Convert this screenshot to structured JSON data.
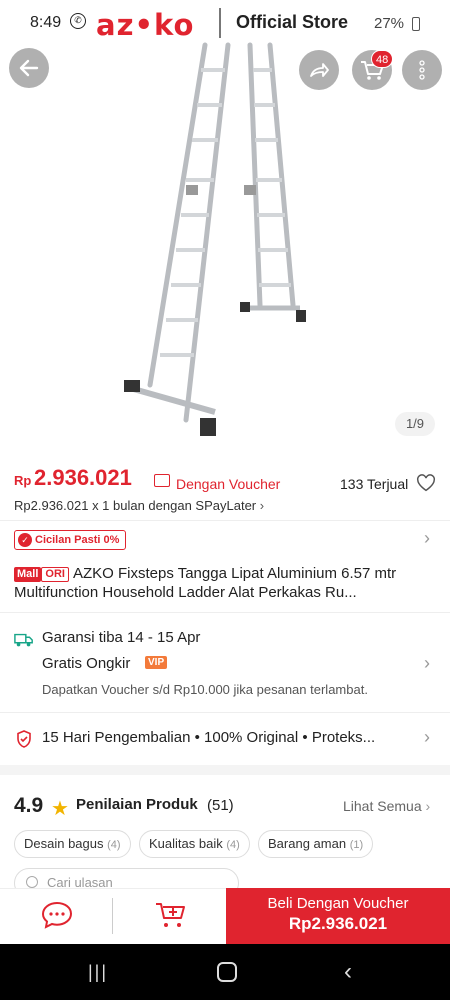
{
  "status_bar": {
    "time": "8:49",
    "battery": "27%"
  },
  "header": {
    "brand": "azko",
    "store_label": "Official Store",
    "cart_count": "48"
  },
  "gallery": {
    "counter": "1/9"
  },
  "price": {
    "currency": "Rp",
    "amount": "2.936.021",
    "voucher_label": "Dengan Voucher",
    "sold": "133 Terjual",
    "installment": "Rp2.936.021 x 1 bulan dengan SPayLater"
  },
  "cicilan": {
    "label": "Cicilan Pasti 0%"
  },
  "product": {
    "mall_badge": "Mall",
    "ori_badge": "ORI",
    "title": "AZKO Fixsteps Tangga Lipat Aluminium 6.57 mtr Multifunction Household Ladder Alat Perkakas Ru..."
  },
  "shipping": {
    "guarantee": "Garansi tiba 14 - 15 Apr",
    "free_shipping": "Gratis Ongkir",
    "vip": "VIP",
    "late_voucher": "Dapatkan Voucher s/d Rp10.000 jika pesanan terlambat."
  },
  "guarantees": {
    "text": "15 Hari Pengembalian  •  100% Original  •  Proteks..."
  },
  "rating": {
    "score": "4.9",
    "label": "Penilaian Produk",
    "count": "(51)",
    "see_all": "Lihat Semua",
    "chips": [
      {
        "label": "Desain bagus",
        "count": "(4)"
      },
      {
        "label": "Kualitas baik",
        "count": "(4)"
      },
      {
        "label": "Barang aman",
        "count": "(1)"
      }
    ],
    "search_placeholder": "Cari ulasan"
  },
  "bottom_bar": {
    "buy_label": "Beli Dengan Voucher",
    "buy_price": "Rp2.936.021"
  },
  "colors": {
    "accent": "#e0242f",
    "vip": "#f37a3a",
    "star": "#f2b400"
  }
}
